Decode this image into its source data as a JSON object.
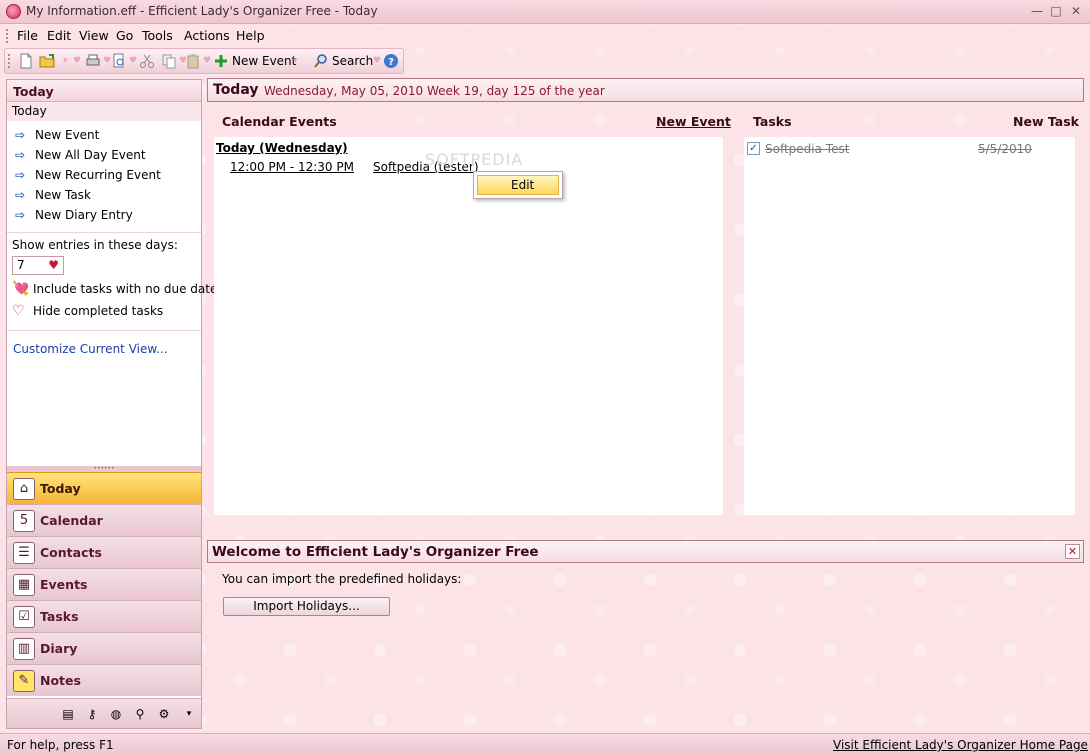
{
  "window": {
    "title": "My Information.eff - Efficient Lady's Organizer Free - Today",
    "minimize": "—",
    "maximize": "□",
    "close": "✕"
  },
  "menu": [
    "File",
    "Edit",
    "View",
    "Go",
    "Tools",
    "Actions",
    "Help"
  ],
  "toolbar": {
    "new_event_label": "New Event",
    "search_label": "Search"
  },
  "left_pane": {
    "header": "Today",
    "subheader": "Today",
    "tasks": [
      "New Event",
      "New All Day Event",
      "New Recurring Event",
      "New Task",
      "New Diary Entry"
    ],
    "show_entries_label": "Show entries in these days:",
    "days_value": "7",
    "include_tasks_label": "Include tasks with no due date",
    "hide_completed_label": "Hide completed tasks",
    "customize_label": "Customize Current View..."
  },
  "nav": {
    "active": "Today",
    "items": [
      "Today",
      "Calendar",
      "Contacts",
      "Events",
      "Tasks",
      "Diary",
      "Notes"
    ]
  },
  "today_header": {
    "title": "Today",
    "info": "Wednesday, May 05, 2010   Week 19, day 125 of the year"
  },
  "calendar_events": {
    "title": "Calendar  Events",
    "new_event": "New Event",
    "day_heading": "Today (Wednesday)",
    "event_time": "12:00 PM - 12:30 PM",
    "event_name": "Softpedia (tester)",
    "context_menu_item": "Edit",
    "watermark": "SOFTPEDIA"
  },
  "tasks_panel": {
    "title": "Tasks",
    "new_task": "New Task",
    "task_name": "Softpedia Test",
    "task_date": "5/5/2010",
    "task_check": "✓"
  },
  "welcome": {
    "title": "Welcome to Efficient Lady's Organizer Free",
    "close": "✕",
    "text": "You can import the predefined holidays:",
    "import_button": "Import Holidays..."
  },
  "status": {
    "text": "For help, press F1",
    "link": "Visit Efficient Lady's Organizer Home Page"
  },
  "colors": {
    "accent": "#c4183a",
    "active_nav": "#f7b534",
    "link": "#1c3ea8"
  }
}
